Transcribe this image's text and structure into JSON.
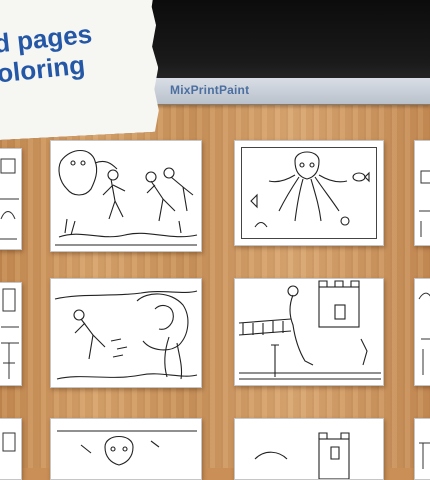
{
  "banner": {
    "line1": "d pages",
    "line2": "oloring"
  },
  "toolbar": {
    "title": "MixPrintPaint"
  },
  "pages": [
    {
      "name": "page-ghost-divers"
    },
    {
      "name": "page-octopus-fish"
    },
    {
      "name": "page-diver-reef"
    },
    {
      "name": "page-mermaid-castle"
    }
  ],
  "colors": {
    "banner_text": "#2457a6",
    "toolbar_title": "#4b6fa0"
  }
}
